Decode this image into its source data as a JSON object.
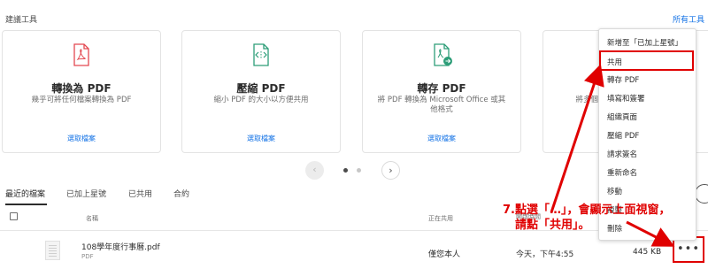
{
  "header": {
    "section_title": "建議工具",
    "all_tools_label": "所有工具"
  },
  "cards": [
    {
      "title": "轉換為 PDF",
      "description": "幾乎可將任何檔案轉換為 PDF",
      "link": "選取檔案",
      "icon": "pdf-convert-icon"
    },
    {
      "title": "壓縮 PDF",
      "description": "縮小 PDF 的大小以方便共用",
      "link": "選取檔案",
      "icon": "compress-icon"
    },
    {
      "title": "轉存 PDF",
      "description": "將 PDF 轉換為 Microsoft Office 或其他格式",
      "link": "選取檔案",
      "icon": "export-icon"
    },
    {
      "title": "",
      "description": "將多個",
      "link": "",
      "icon": "combine-icon"
    }
  ],
  "pager": {
    "prev": "‹",
    "next": "›",
    "active_page": 1,
    "total_pages": 2
  },
  "tabs": [
    "最近的檔案",
    "已加上星號",
    "已共用",
    "合約"
  ],
  "table": {
    "columns": {
      "name": "名稱",
      "shared": "正在共用",
      "opened": "開啟時間"
    },
    "rows": [
      {
        "name": "108學年度行事曆.pdf",
        "type": "PDF",
        "shared": "僅您本人",
        "date": "今天，下午4:55",
        "size": "445 KB",
        "more": "•••"
      }
    ]
  },
  "menu": {
    "items": [
      "新增至「已加上星號」",
      "共用",
      "轉存 PDF",
      "填寫和簽署",
      "組織頁面",
      "壓縮 PDF",
      "請求簽名",
      "重新命名",
      "移動",
      "複製",
      "刪除"
    ]
  },
  "annotation": {
    "line1": "7.點選「…」，會顯示上面視窗，",
    "line2": "請點「共用」。"
  },
  "colors": {
    "accent": "#1473e6",
    "annotation": "#e00000",
    "pdf_red": "#e34850",
    "export_teal": "#2d9d78"
  }
}
